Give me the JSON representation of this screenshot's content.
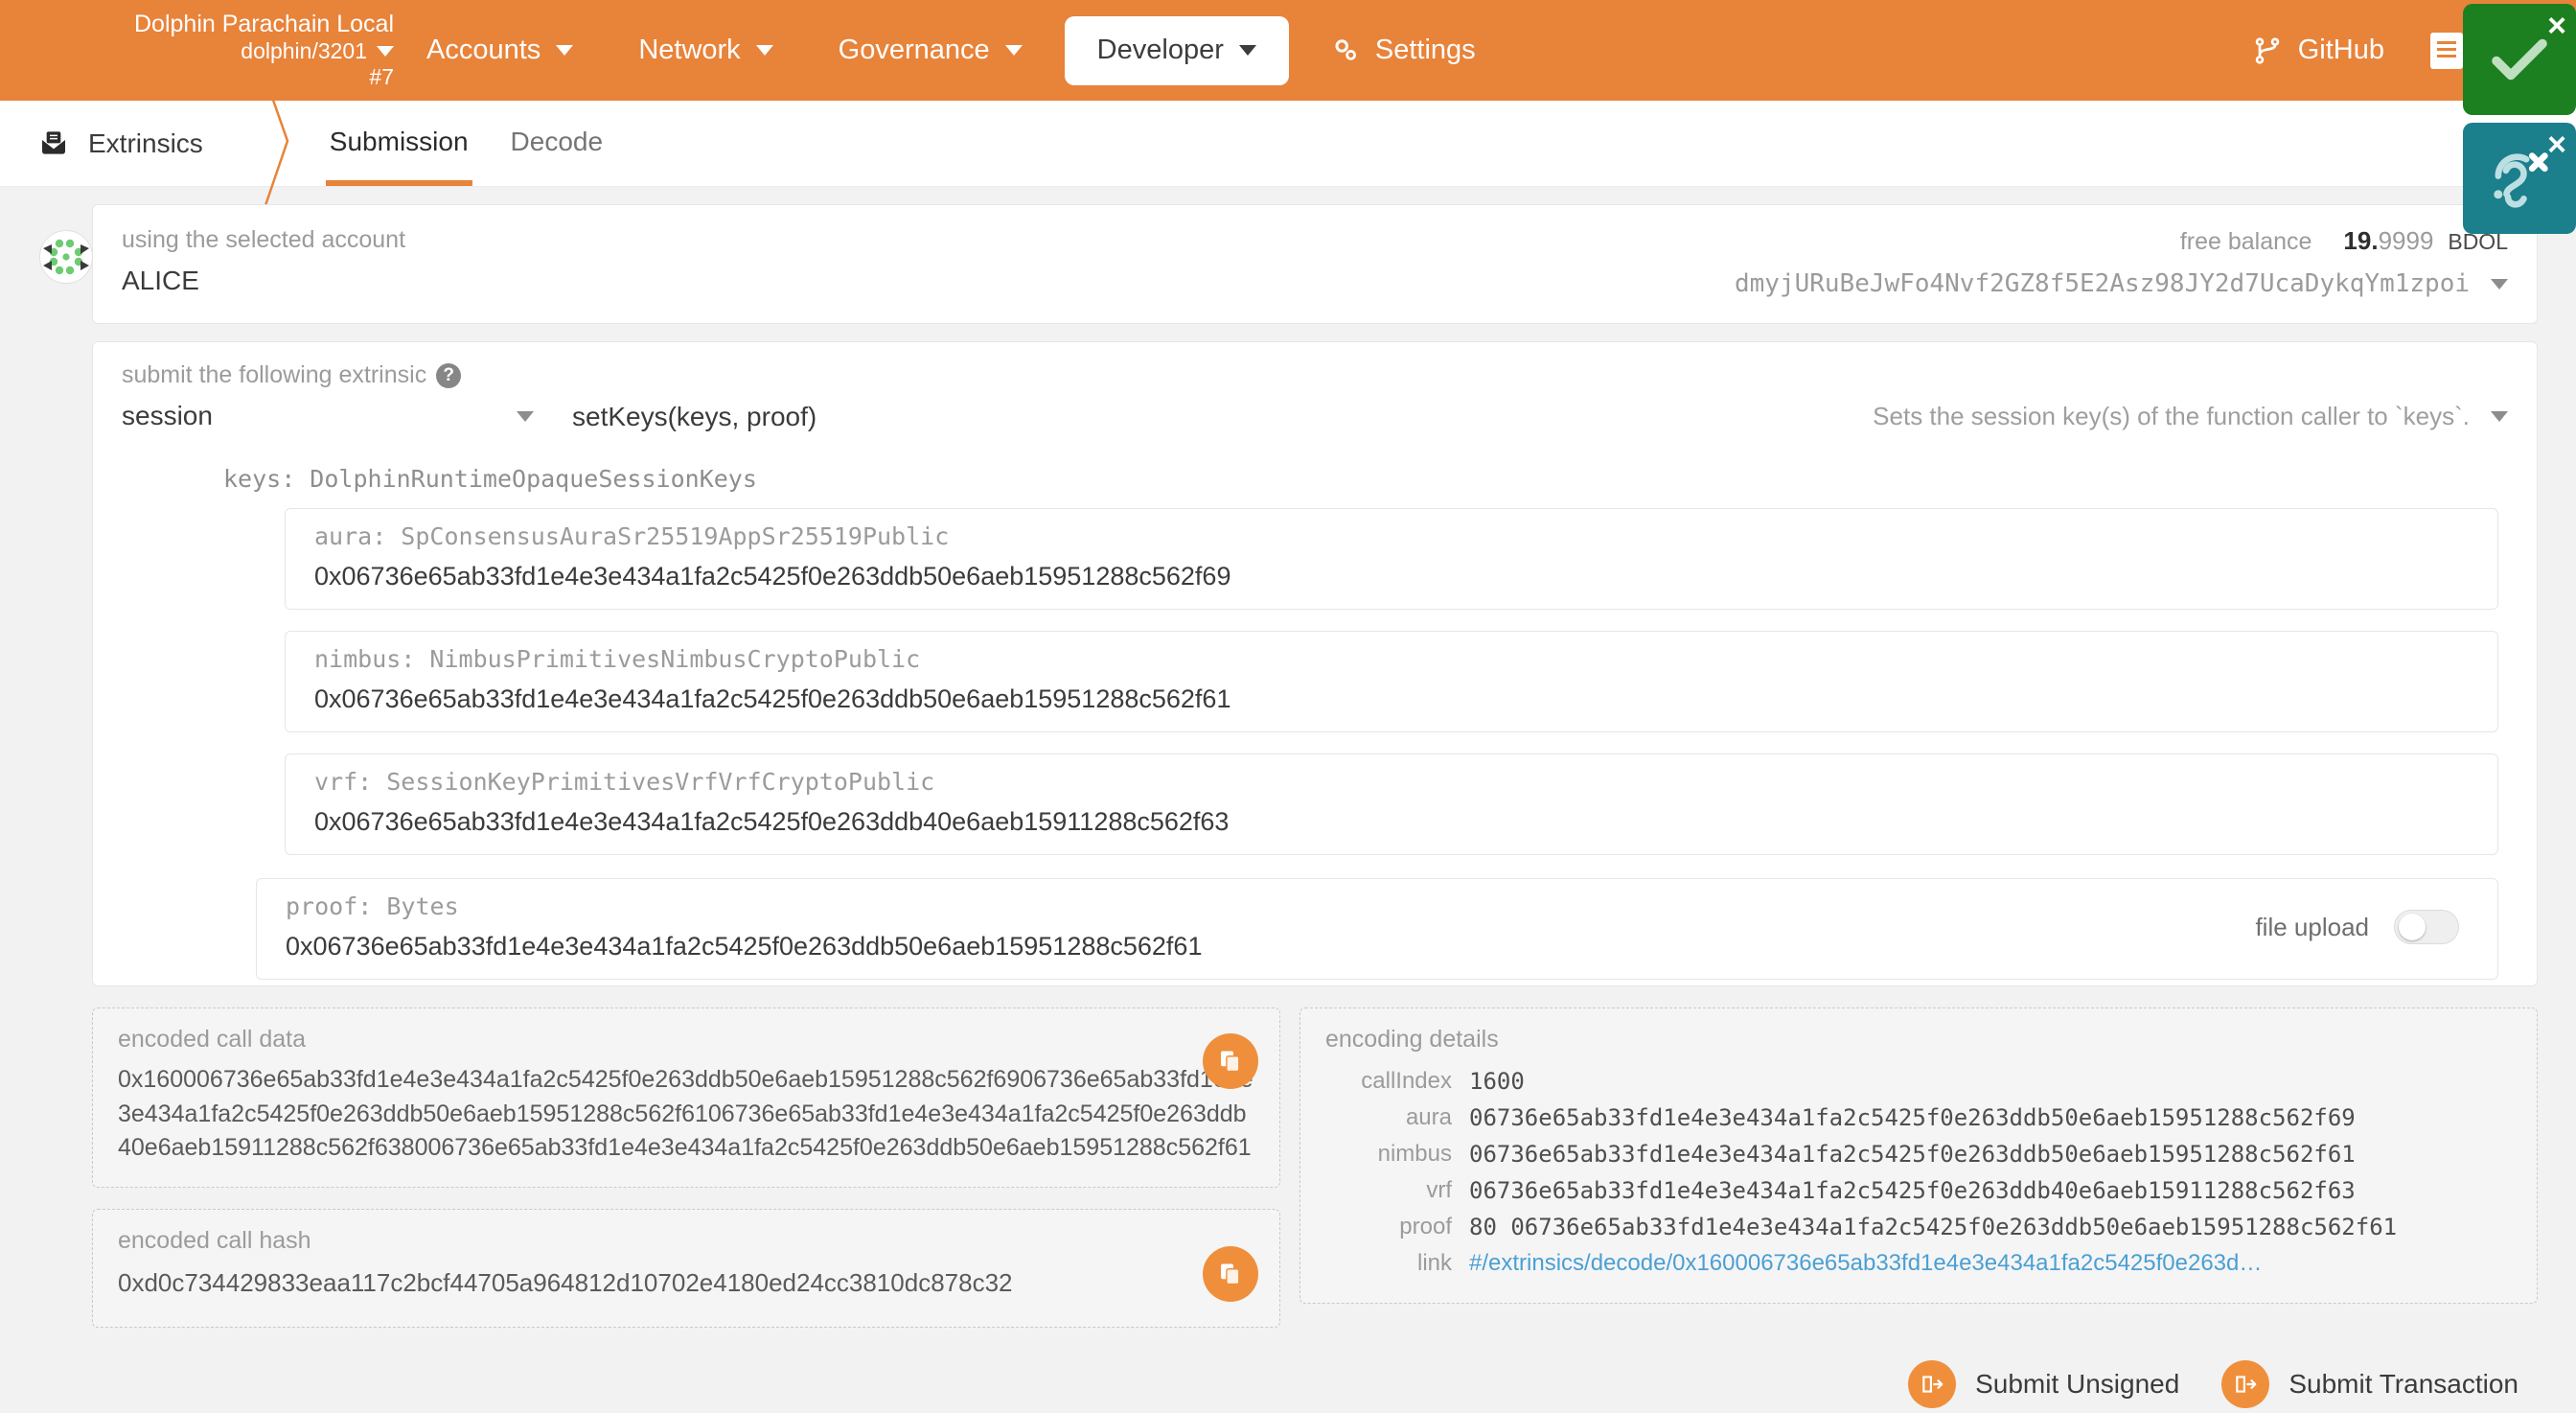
{
  "topnav": {
    "chain_name": "Dolphin Parachain Local",
    "chain_spec": "dolphin/3201",
    "block_number": "#7",
    "items": [
      {
        "label": "Accounts",
        "active": false
      },
      {
        "label": "Network",
        "active": false
      },
      {
        "label": "Governance",
        "active": false
      },
      {
        "label": "Developer",
        "active": true
      },
      {
        "label": "Settings",
        "active": false
      }
    ],
    "github_label": "GitHub"
  },
  "badges": {
    "success_close": "×",
    "sound_close": "×"
  },
  "tabbar": {
    "section": "Extrinsics",
    "tabs": [
      {
        "label": "Submission",
        "active": true
      },
      {
        "label": "Decode",
        "active": false
      }
    ]
  },
  "account": {
    "label": "using the selected account",
    "name": "ALICE",
    "balance_label": "free balance",
    "balance_int": "19.",
    "balance_frac": "9999",
    "balance_unit": "BDOL",
    "address": "dmyjURuBeJwFo4Nvf2GZ8f5E2Asz98JY2d7UcaDykqYm1zpoi"
  },
  "extrinsic": {
    "label": "submit the following extrinsic",
    "help_icon": "?",
    "pallet": "session",
    "method": "setKeys(keys, proof)",
    "docs": "Sets the session key(s) of the function caller to `keys`."
  },
  "keys": {
    "group_label": "keys: DolphinRuntimeOpaqueSessionKeys",
    "fields": [
      {
        "label": "aura: SpConsensusAuraSr25519AppSr25519Public",
        "value": "0x06736e65ab33fd1e4e3e434a1fa2c5425f0e263ddb50e6aeb15951288c562f69"
      },
      {
        "label": "nimbus: NimbusPrimitivesNimbusCryptoPublic",
        "value": "0x06736e65ab33fd1e4e3e434a1fa2c5425f0e263ddb50e6aeb15951288c562f61"
      },
      {
        "label": "vrf: SessionKeyPrimitivesVrfVrfCryptoPublic",
        "value": "0x06736e65ab33fd1e4e3e434a1fa2c5425f0e263ddb40e6aeb15911288c562f63"
      }
    ]
  },
  "proof": {
    "label": "proof: Bytes",
    "value": "0x06736e65ab33fd1e4e3e434a1fa2c5425f0e263ddb50e6aeb15951288c562f61",
    "upload_label": "file upload",
    "upload_on": false
  },
  "encoded": {
    "call_data_title": "encoded call data",
    "call_data": "0x160006736e65ab33fd1e4e3e434a1fa2c5425f0e263ddb50e6aeb15951288c562f6906736e65ab33fd1e4e3e434a1fa2c5425f0e263ddb50e6aeb15951288c562f6106736e65ab33fd1e4e3e434a1fa2c5425f0e263ddb40e6aeb15911288c562f638006736e65ab33fd1e4e3e434a1fa2c5425f0e263ddb50e6aeb15951288c562f61",
    "call_hash_title": "encoded call hash",
    "call_hash": "0xd0c734429833eaa117c2bcf44705a964812d10702e4180ed24cc3810dc878c32",
    "copy_icon": "copy-icon"
  },
  "details": {
    "title": "encoding details",
    "rows": [
      {
        "key": "callIndex",
        "value": "1600"
      },
      {
        "key": "aura",
        "value": "06736e65ab33fd1e4e3e434a1fa2c5425f0e263ddb50e6aeb15951288c562f69"
      },
      {
        "key": "nimbus",
        "value": "06736e65ab33fd1e4e3e434a1fa2c5425f0e263ddb50e6aeb15951288c562f61"
      },
      {
        "key": "vrf",
        "value": "06736e65ab33fd1e4e3e434a1fa2c5425f0e263ddb40e6aeb15911288c562f63"
      },
      {
        "key": "proof",
        "value": "80 06736e65ab33fd1e4e3e434a1fa2c5425f0e263ddb50e6aeb15951288c562f61"
      },
      {
        "key": "link",
        "value": "#/extrinsics/decode/0x160006736e65ab33fd1e4e3e434a1fa2c5425f0e263d…"
      }
    ]
  },
  "actions": {
    "submit_unsigned": "Submit Unsigned",
    "submit_transaction": "Submit Transaction"
  }
}
